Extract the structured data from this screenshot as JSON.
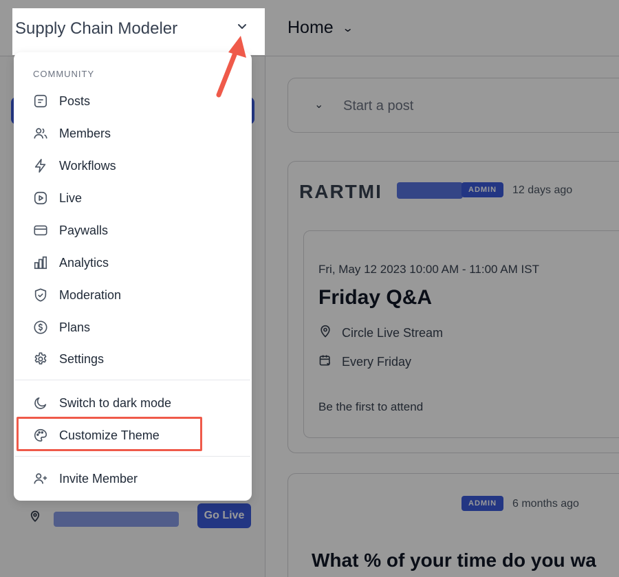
{
  "app": {
    "title": "Supply Chain Modeler"
  },
  "header": {
    "page_title": "Home"
  },
  "composer": {
    "placeholder": "Start a post"
  },
  "menu": {
    "section_heading": "COMMUNITY",
    "items": [
      {
        "label": "Posts",
        "icon": "posts-icon"
      },
      {
        "label": "Members",
        "icon": "members-icon"
      },
      {
        "label": "Workflows",
        "icon": "lightning-icon"
      },
      {
        "label": "Live",
        "icon": "play-icon"
      },
      {
        "label": "Paywalls",
        "icon": "card-icon"
      },
      {
        "label": "Analytics",
        "icon": "bar-chart-icon"
      },
      {
        "label": "Moderation",
        "icon": "shield-icon"
      },
      {
        "label": "Plans",
        "icon": "dollar-circle-icon"
      },
      {
        "label": "Settings",
        "icon": "gear-icon"
      }
    ],
    "dark_mode_label": "Switch to dark mode",
    "customize_label": "Customize Theme",
    "invite_label": "Invite Member"
  },
  "feed": {
    "post1": {
      "author_logo": "RARTMI",
      "badge": "ADMIN",
      "time": "12 days ago",
      "event": {
        "datetime": "Fri, May 12 2023 10:00 AM - 11:00 AM IST",
        "title": "Friday Q&A",
        "location": "Circle Live Stream",
        "recurrence": "Every Friday",
        "attend_text": "Be the first to attend"
      }
    },
    "post2": {
      "badge": "ADMIN",
      "time": "6 months ago",
      "title": "What % of your time do you wa"
    }
  },
  "sidebar_bottom": {
    "go_live_label": "Go Live"
  },
  "colors": {
    "accent": "#3b5bdb",
    "highlight": "#ef5a4a",
    "overlay": "rgba(0,0,0,0.40)"
  }
}
